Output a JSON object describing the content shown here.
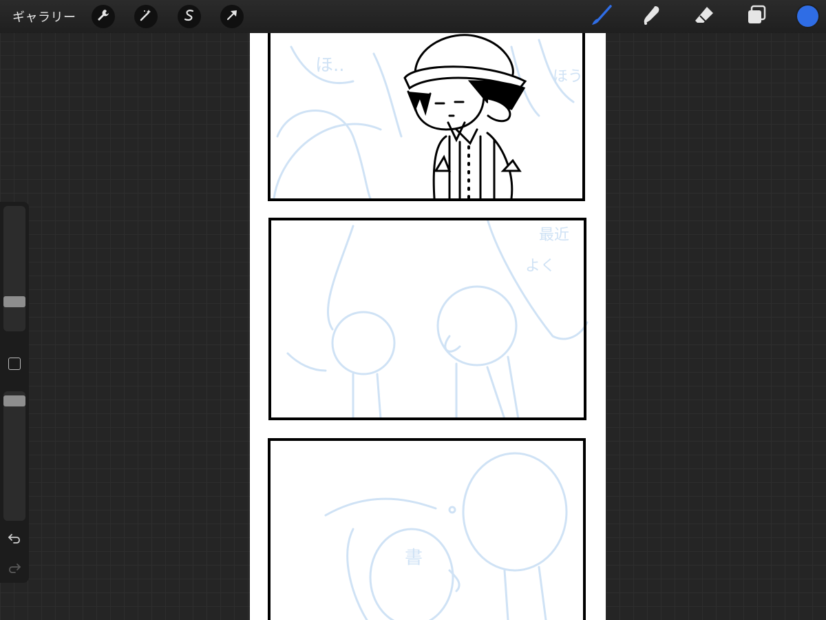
{
  "app": {
    "gallery_label": "ギャラリー",
    "accent_color": "#2f6de5",
    "current_color": "#2f6de5"
  },
  "toolbar_left": [
    {
      "name": "adjustments",
      "icon": "wrench-icon"
    },
    {
      "name": "magic",
      "icon": "magic-wand-icon"
    },
    {
      "name": "selection",
      "icon": "selection-s-icon"
    },
    {
      "name": "transform",
      "icon": "arrow-cursor-icon"
    }
  ],
  "toolbar_right": [
    {
      "name": "brush",
      "icon": "brush-icon",
      "active": true
    },
    {
      "name": "smudge",
      "icon": "smudge-finger-icon",
      "active": false
    },
    {
      "name": "eraser",
      "icon": "eraser-icon",
      "active": false
    },
    {
      "name": "layers",
      "icon": "layers-icon",
      "active": false
    }
  ],
  "sidebar": {
    "brush_size_level": 0.26,
    "opacity_level": 0.98,
    "modify_icon": "square-icon",
    "undo_icon": "undo-icon",
    "redo_icon": "redo-icon"
  },
  "canvas": {
    "description_panels": 3,
    "sketch_color": "#cfe2f5",
    "ink_color": "#000000"
  }
}
